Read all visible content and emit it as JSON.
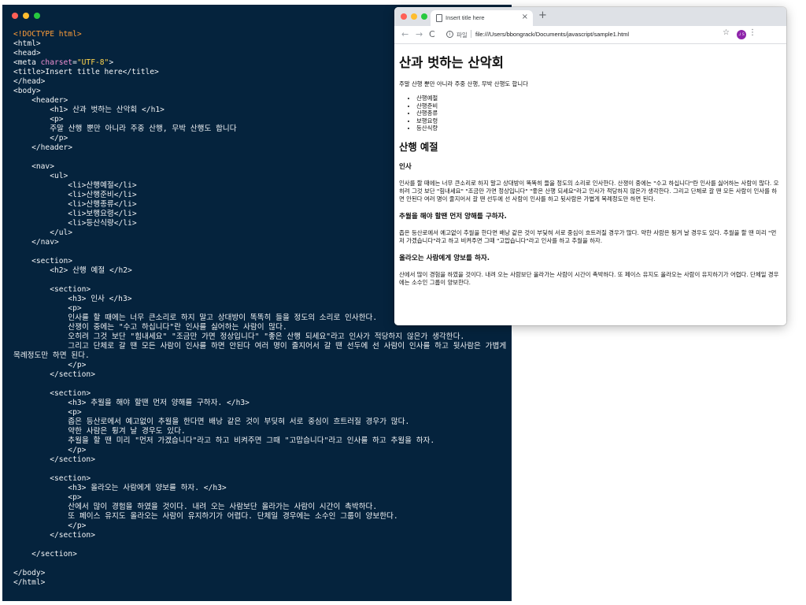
{
  "colors": {
    "editor_bg": "#05233d",
    "tag_orange": "#ff9d38",
    "attr_pink": "#f08fd1",
    "string_yellow": "#ffd54d",
    "avatar_purple": "#8e24aa"
  },
  "editor": {
    "lines": [
      [
        {
          "t": "<!DOCTYPE html>",
          "c": "t-orange"
        }
      ],
      [
        {
          "t": "<html>"
        }
      ],
      [
        {
          "t": "<head>"
        }
      ],
      [
        {
          "t": "<meta "
        },
        {
          "t": "charset",
          "c": "t-attr"
        },
        {
          "t": "="
        },
        {
          "t": "\"UTF-8\"",
          "c": "t-str"
        },
        {
          "t": ">"
        }
      ],
      [
        {
          "t": "<title>Insert title here</title>"
        }
      ],
      [
        {
          "t": "</head>"
        }
      ],
      [
        {
          "t": "<body>"
        }
      ],
      [
        {
          "t": "    <header>"
        }
      ],
      [
        {
          "t": "        <h1> 산과 벗하는 산악회 </h1>"
        }
      ],
      [
        {
          "t": "        <p>"
        }
      ],
      [
        {
          "t": "        주말 산행 뿐만 아니라 주중 산행, 무박 산행도 합니다"
        }
      ],
      [
        {
          "t": "        </p>"
        }
      ],
      [
        {
          "t": "    </header>"
        }
      ],
      [
        {
          "t": ""
        }
      ],
      [
        {
          "t": "    <nav>"
        }
      ],
      [
        {
          "t": "        <ul>"
        }
      ],
      [
        {
          "t": "            <li>산행예절</li>"
        }
      ],
      [
        {
          "t": "            <li>산행준비</li>"
        }
      ],
      [
        {
          "t": "            <li>산행종류</li>"
        }
      ],
      [
        {
          "t": "            <li>보행요령</li>"
        }
      ],
      [
        {
          "t": "            <li>등산식량</li>"
        }
      ],
      [
        {
          "t": "        </ul>"
        }
      ],
      [
        {
          "t": "    </nav>"
        }
      ],
      [
        {
          "t": ""
        }
      ],
      [
        {
          "t": "    <section>"
        }
      ],
      [
        {
          "t": "        <h2> 산행 예절 </h2>"
        }
      ],
      [
        {
          "t": ""
        }
      ],
      [
        {
          "t": "        <section>"
        }
      ],
      [
        {
          "t": "            <h3> 인사 </h3>"
        }
      ],
      [
        {
          "t": "            <p>"
        }
      ],
      [
        {
          "t": "            인사를 할 때에는 너무 큰소리로 하지 말고 상대방이 똑똑히 들을 정도의 소리로 인사한다."
        }
      ],
      [
        {
          "t": "            산쟁이 중에는 \"수고 하십니다\"란 인사를 싫어하는 사람이 많다."
        }
      ],
      [
        {
          "t": "            오히려 그것 보단 \"힘내세요\" \"조금만 가면 정상입니다\" \"좋은 산행 되세요\"라고 인사가 적당하지 않은가 생각한다."
        }
      ],
      [
        {
          "t": "            그리고 단체로 갈 땐 모든 사람이 인사를 하면 안된다 여러 명이 줄지어서 갈 땐 선두에 선 사람이 인사를 하고 뒷사람은 가볍게"
        }
      ],
      [
        {
          "t": "목례정도만 하면 된다."
        }
      ],
      [
        {
          "t": "            </p>"
        }
      ],
      [
        {
          "t": "        </section>"
        }
      ],
      [
        {
          "t": ""
        }
      ],
      [
        {
          "t": "        <section>"
        }
      ],
      [
        {
          "t": "            <h3> 추월을 해야 할땐 먼저 양해를 구하자. </h3>"
        }
      ],
      [
        {
          "t": "            <p>"
        }
      ],
      [
        {
          "t": "            좁은 등산로에서 예고없이 추월을 한다면 배낭 같은 것이 부딪혀 서로 중심이 흐트러질 경우가 많다."
        }
      ],
      [
        {
          "t": "            약한 사람은 튕겨 날 경우도 있다."
        }
      ],
      [
        {
          "t": "            추월을 할 땐 미리 \"먼저 가겠습니다\"라고 하고 비켜주면 그때 \"고맙습니다\"라고 인사를 하고 추월을 하자."
        }
      ],
      [
        {
          "t": "            </p>"
        }
      ],
      [
        {
          "t": "        </section>"
        }
      ],
      [
        {
          "t": ""
        }
      ],
      [
        {
          "t": "        <section>"
        }
      ],
      [
        {
          "t": "            <h3> 올라오는 사람에게 양보를 하자. </h3>"
        }
      ],
      [
        {
          "t": "            <p>"
        }
      ],
      [
        {
          "t": "            산에서 많이 경험을 하였을 것이다. 내려 오는 사람보단 올라가는 사람이 시간이 촉박하다."
        }
      ],
      [
        {
          "t": "            또 페이스 유지도 올라오는 사람이 유지하기가 어렵다. 단체일 경우에는 소수인 그룹이 양보한다."
        }
      ],
      [
        {
          "t": "            </p>"
        }
      ],
      [
        {
          "t": "        </section>"
        }
      ],
      [
        {
          "t": ""
        }
      ],
      [
        {
          "t": "    </section>"
        }
      ],
      [
        {
          "t": ""
        }
      ],
      [
        {
          "t": "</body>"
        }
      ],
      [
        {
          "t": "</html>"
        }
      ]
    ]
  },
  "browser": {
    "tab_title": "Insert title here",
    "tab_close": "×",
    "new_tab": "+",
    "back": "←",
    "forward": "→",
    "reload": "C",
    "info": "i",
    "scheme_label": "파일",
    "url": "file:///Users/bbongrack/Documents/javascript/sample1.html",
    "star": "☆",
    "avatar_initials": "ＪＳ",
    "menu": "⋮"
  },
  "page": {
    "h1": "산과 벗하는 산악회",
    "intro": "주말 산행 뿐만 아니라 주중 산행, 무박 산행도 합니다",
    "nav": [
      "산행예절",
      "산행준비",
      "산행종류",
      "보행요령",
      "등산식량"
    ],
    "h2": "산행 예절",
    "sections": [
      {
        "h3": "인사",
        "p": "인사를 할 때에는 너무 큰소리로 하지 말고 상대방이 똑똑히 들을 정도의 소리로 인사한다. 산쟁이 중에는 \"수고 하십니다\"란 인사를 싫어하는 사람이 많다. 오히려 그것 보단 \"힘내세요\" \"조금만 가면 정상입니다\" \"좋은 산행 되세요\"라고 인사가 적당하지 않은가 생각한다. 그리고 단체로 갈 땐 모든 사람이 인사를 하면 안된다 여러 명이 줄지어서 갈 땐 선두에 선 사람이 인사를 하고 뒷사람은 가볍게 목례정도만 하면 된다."
      },
      {
        "h3": "추월을 해야 할땐 먼저 양해를 구하자.",
        "p": "좁은 등산로에서 예고없이 추월을 한다면 배낭 같은 것이 부딪혀 서로 중심이 흐트러질 경우가 많다. 약한 사람은 튕겨 날 경우도 있다. 추월을 할 땐 미리 \"먼저 가겠습니다\"라고 하고 비켜주면 그때 \"고맙습니다\"라고 인사를 하고 추월을 하자."
      },
      {
        "h3": "올라오는 사람에게 양보를 하자.",
        "p": "산에서 많이 경험을 하였을 것이다. 내려 오는 사람보단 올라가는 사람이 시간이 촉박하다. 또 페이스 유지도 올라오는 사람이 유지하기가 어렵다. 단체일 경우에는 소수인 그룹이 양보한다."
      }
    ]
  }
}
